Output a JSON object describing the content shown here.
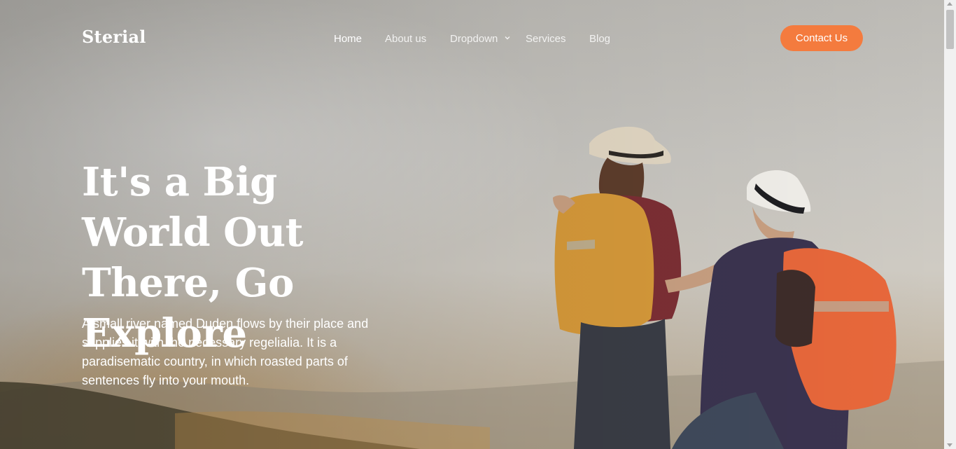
{
  "brand": {
    "name": "Sterial"
  },
  "nav": {
    "items": [
      {
        "label": "Home",
        "active": true
      },
      {
        "label": "About us",
        "active": false
      },
      {
        "label": "Dropdown",
        "active": false,
        "icon": "chevron-down-icon"
      },
      {
        "label": "Services",
        "active": false
      },
      {
        "label": "Blog",
        "active": false
      }
    ],
    "contact_label": "Contact Us"
  },
  "hero": {
    "title": "It's a Big World Out There, Go Explore",
    "text": "A small river named Duden flows by their place and supplies it with the necessary regelialia. It is a paradisematic country, in which roasted parts of sentences fly into your mouth."
  },
  "colors": {
    "accent": "#f47b3e",
    "text_on_image": "#ffffff"
  }
}
